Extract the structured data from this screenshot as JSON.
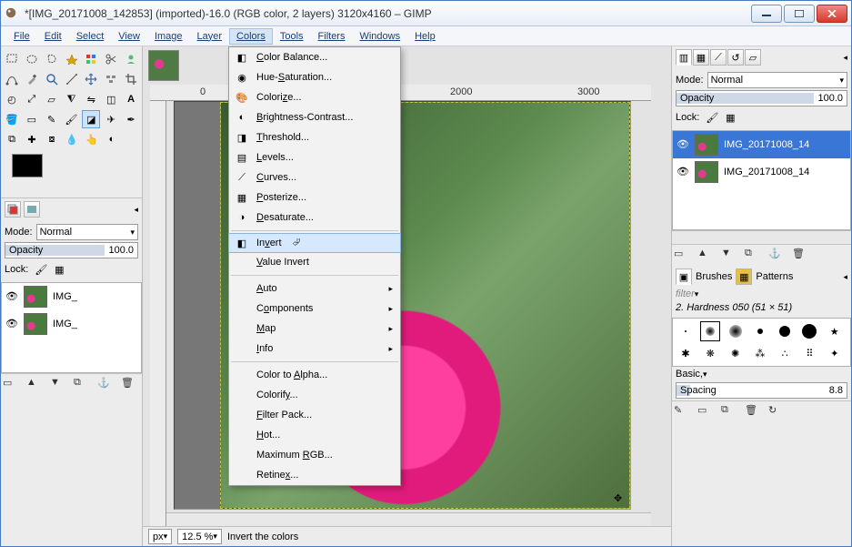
{
  "window": {
    "title": "*[IMG_20171008_142853] (imported)-16.0 (RGB color, 2 layers) 3120x4160 – GIMP"
  },
  "menubar": {
    "file": "File",
    "edit": "Edit",
    "select": "Select",
    "view": "View",
    "image": "Image",
    "layer": "Layer",
    "colors": "Colors",
    "tools": "Tools",
    "filters": "Filters",
    "windows": "Windows",
    "help": "Help"
  },
  "colors_menu": {
    "color_balance": "Color Balance...",
    "hue_saturation": "Hue-Saturation...",
    "colorize": "Colorize...",
    "brightness_contrast": "Brightness-Contrast...",
    "threshold": "Threshold...",
    "levels": "Levels...",
    "curves": "Curves...",
    "posterize": "Posterize...",
    "desaturate": "Desaturate...",
    "invert": "Invert",
    "value_invert": "Value Invert",
    "auto": "Auto",
    "components": "Components",
    "map": "Map",
    "info": "Info",
    "color_to_alpha": "Color to Alpha...",
    "colorify": "Colorify...",
    "filter_pack": "Filter Pack...",
    "hot": "Hot...",
    "maximum_rgb": "Maximum RGB...",
    "retinex": "Retinex..."
  },
  "left": {
    "mode_label": "Mode:",
    "mode_value": "Normal",
    "opacity_label": "Opacity",
    "opacity_value": "100.0",
    "lock_label": "Lock:",
    "layers": [
      {
        "name": "IMG_"
      },
      {
        "name": "IMG_"
      }
    ]
  },
  "right": {
    "mode_label": "Mode:",
    "mode_value": "Normal",
    "opacity_label": "Opacity",
    "opacity_value": "100.0",
    "lock_label": "Lock:",
    "layers": [
      {
        "name": "IMG_20171008_14"
      },
      {
        "name": "IMG_20171008_14"
      }
    ],
    "brushes_tab": "Brushes",
    "patterns_tab": "Patterns",
    "filter_placeholder": "filter",
    "brush_label": "2. Hardness 050 (51 × 51)",
    "basic_label": "Basic,",
    "spacing_label": "Spacing",
    "spacing_value": "8.8"
  },
  "ruler": {
    "t0": "0",
    "t1": "2000",
    "t2": "3000"
  },
  "status": {
    "unit": "px",
    "zoom": "12.5 %",
    "hint": "Invert the colors"
  }
}
